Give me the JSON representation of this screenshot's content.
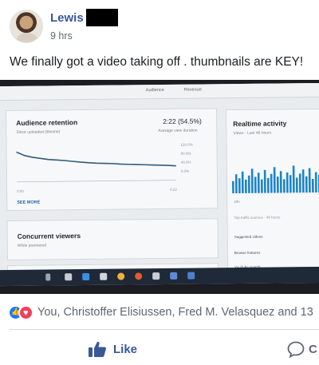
{
  "post": {
    "author": "Lewis",
    "time": "9 hrs",
    "text": "We finally got a video taking off . thumbnails are KEY!",
    "photo": {
      "tabs": [
        "Audience",
        "Revenue"
      ],
      "retention_card": {
        "title": "Audience retention",
        "subtitle": "Since uploaded (lifetime)",
        "stat": "2:22 (54.5%)",
        "stat_caption": "Average view duration",
        "y_ticks": [
          "120.0%",
          "80.0%",
          "40.0%",
          "0.0%"
        ],
        "x_start": "0:00",
        "x_end": "4:22",
        "see_more": "SEE MORE",
        "retention_curve_pct": [
          100,
          88,
          82,
          78,
          74,
          72,
          70,
          67,
          64,
          62,
          60,
          59,
          58,
          56,
          55,
          54,
          53,
          52,
          51,
          50,
          48
        ]
      },
      "realtime_card": {
        "title": "Realtime activity",
        "subtitle": "Views · Last 48 hours",
        "axis_label": "48h",
        "traffic_header": "Top traffic sources · 48 hours",
        "sources": [
          "Suggested videos",
          "Browse features",
          "YouTube search"
        ],
        "bar_levels": [
          0.45,
          0.7,
          0.55,
          0.8,
          0.5,
          0.65,
          0.9,
          0.6,
          0.75,
          0.5,
          0.85,
          0.55,
          0.7,
          0.95,
          0.6,
          0.8,
          0.5,
          0.75,
          0.65,
          1.0,
          0.55,
          0.7,
          0.85,
          0.6,
          0.9,
          0.5,
          0.75,
          0.65,
          0.8,
          0.95
        ]
      },
      "concurrent_card": {
        "title": "Concurrent viewers",
        "subtitle": "While premiered"
      }
    }
  },
  "reactions": {
    "names": "You, Christoffer Elisiussen, Fred M. Velasquez and 13"
  },
  "actions": {
    "like": "Like",
    "comment": "C"
  },
  "colors": {
    "link_blue": "#385898",
    "like_blue": "#2078f4",
    "love_red": "#f33e58",
    "chart_line": "#2f5c7a",
    "realtime_bars": "#1c84c6"
  }
}
